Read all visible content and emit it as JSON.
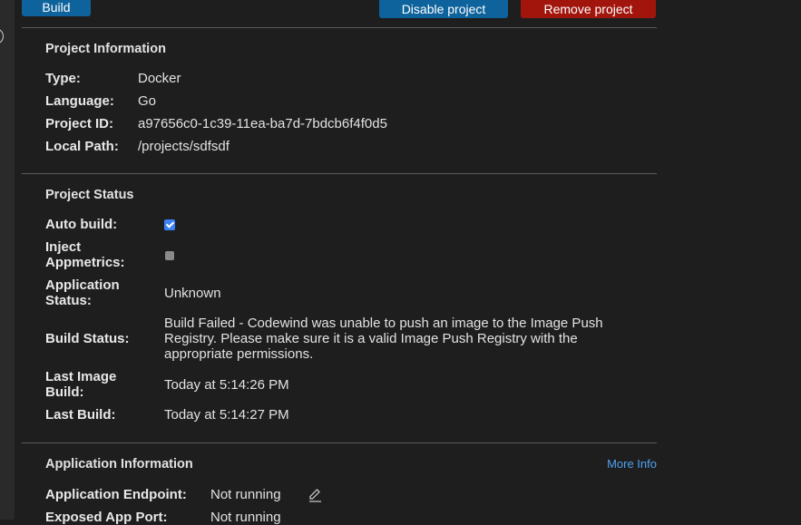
{
  "toolbar": {
    "build_label": "Build",
    "disable_label": "Disable project",
    "remove_label": "Remove project"
  },
  "project_information": {
    "title": "Project Information",
    "type_label": "Type:",
    "type_value": "Docker",
    "language_label": "Language:",
    "language_value": "Go",
    "id_label": "Project ID:",
    "id_value": "a97656c0-1c39-11ea-ba7d-7bdcb6f4f0d5",
    "path_label": "Local Path:",
    "path_value": "/projects/sdfsdf"
  },
  "project_status": {
    "title": "Project Status",
    "auto_build_label": "Auto build:",
    "auto_build_checked": true,
    "inject_label_1": "Inject",
    "inject_label_2": "Appmetrics:",
    "inject_checked": false,
    "app_status_label_1": "Application",
    "app_status_label_2": "Status:",
    "app_status_value": "Unknown",
    "build_status_label": "Build Status:",
    "build_status_line1": "Build Failed - Codewind was unable to push an image to the Image Push",
    "build_status_line2": "Registry. Please make sure it is a valid Image Push Registry with the",
    "build_status_line3": "appropriate permissions.",
    "last_image_label_1": "Last Image",
    "last_image_label_2": "Build:",
    "last_image_value": "Today at 5:14:26 PM",
    "last_build_label": "Last Build:",
    "last_build_value": "Today at 5:14:27 PM"
  },
  "application_information": {
    "title": "Application Information",
    "more_info": "More Info",
    "endpoint_label": "Application Endpoint:",
    "endpoint_value": "Not running",
    "port_label": "Exposed App Port:",
    "port_value": "Not running"
  },
  "colors": {
    "background": "#1e1e1e",
    "primary_button": "#0e639c",
    "danger_button": "#a1150d",
    "link": "#4ea3f1",
    "checkbox_checked": "#3b82f6"
  }
}
